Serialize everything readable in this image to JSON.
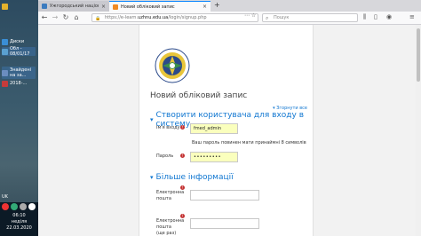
{
  "desktop": {
    "icons": [
      {
        "label": "",
        "color": "#e4b22c"
      },
      {
        "label": "Диски",
        "color": "#3a8ed6"
      },
      {
        "label": "Обл - 08/01/17",
        "color": "#5aa0d0"
      },
      {
        "label": "Знайдені на за...",
        "color": "#6b8dbf"
      },
      {
        "label": "2018-...",
        "color": "#c63b3b"
      }
    ],
    "language": "UK",
    "clock": {
      "time": "06:10",
      "day": "неділя",
      "date": "22.03.2020"
    }
  },
  "browser": {
    "tabs": [
      {
        "label": "Ужгородський національни..."
      },
      {
        "label": "Новий обліковий запис",
        "active": true
      }
    ],
    "url": {
      "prefix": "https://e-learn.",
      "host": "uzhnu.edu.ua",
      "path": "/login/signup.php"
    },
    "search_placeholder": "Пошук"
  },
  "page": {
    "heading": "Новий обліковий запис",
    "collapse_all": "Згорнути все",
    "section1": {
      "title": "Створити користувача для входу в систему",
      "username_label": "Ім'я входу",
      "username_value": "fmed_admin",
      "password_hint": "Ваш пароль повинен мати принаймні 8 символів",
      "password_label": "Пароль",
      "password_value": "•••••••••"
    },
    "section2": {
      "title": "Більше інформації",
      "email_label": "Електронна пошта",
      "email2_label": "Електронна пошта (ще раз)"
    }
  }
}
